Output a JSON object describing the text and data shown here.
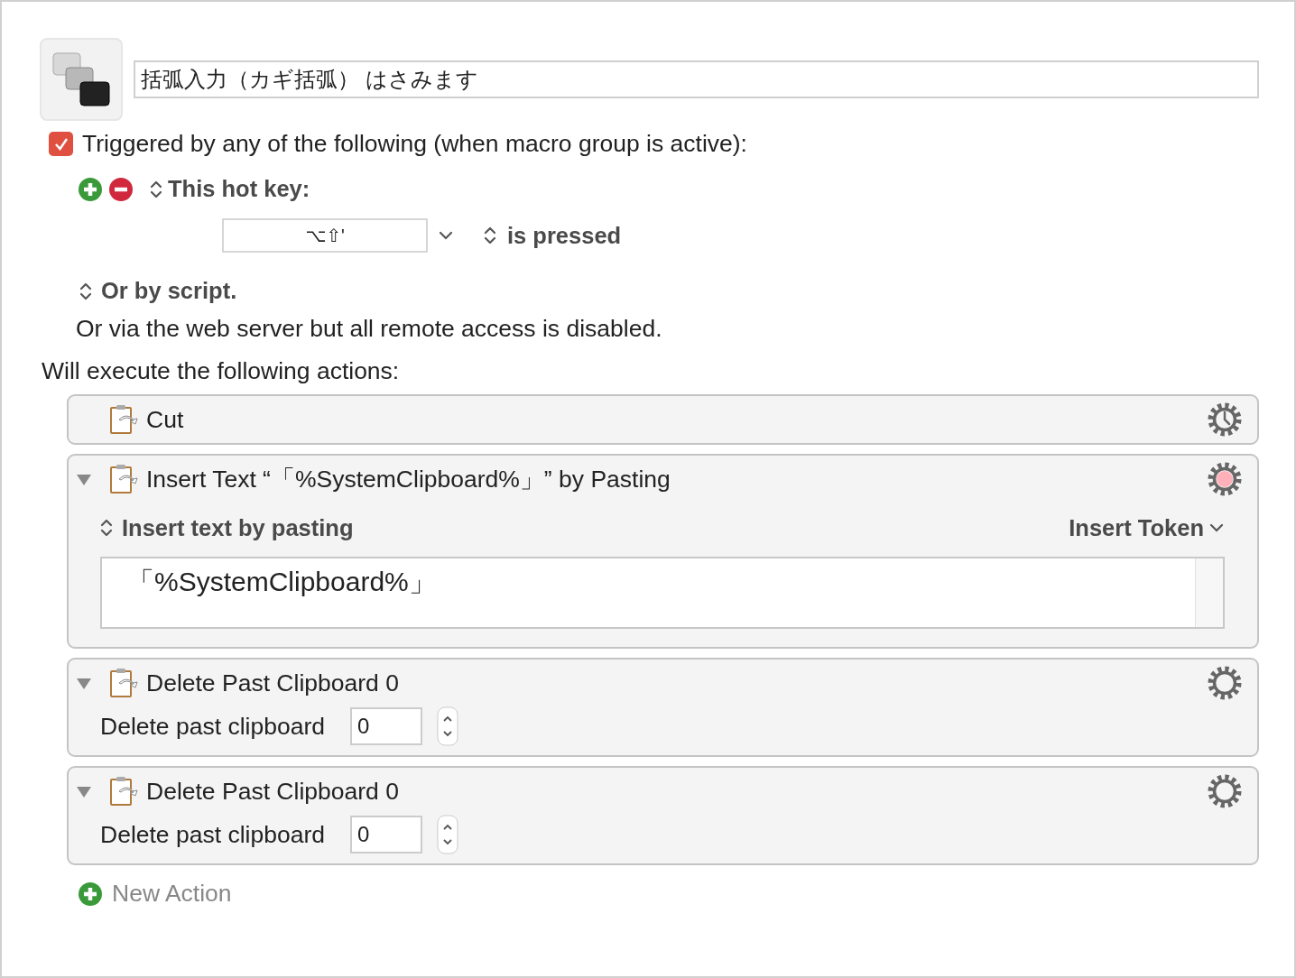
{
  "macro": {
    "name": "括弧入力（カギ括弧） はさみます"
  },
  "trigger": {
    "checked": true,
    "label": "Triggered by any of the following (when macro group is active):"
  },
  "hotkey": {
    "type_label": "This hot key:",
    "keys": "⌥⇧'",
    "state_label": "is pressed"
  },
  "script_label": "Or by script.",
  "web_server_note": "Or via the web server but all remote access is disabled.",
  "actions_heading": "Will execute the following actions:",
  "actions": [
    {
      "kind": "simple",
      "title": "Cut",
      "timed": true,
      "failed": false
    },
    {
      "kind": "insert_text",
      "title": "Insert Text “「%SystemClipboard%」” by Pasting",
      "expanded": true,
      "timed": false,
      "failed": true,
      "mode_label": "Insert text by pasting",
      "token_button": "Insert Token",
      "text": "「%SystemClipboard%」"
    },
    {
      "kind": "delete_clipboard",
      "title": "Delete Past Clipboard 0",
      "expanded": true,
      "timed": false,
      "failed": false,
      "field_label": "Delete past clipboard",
      "value": "0"
    },
    {
      "kind": "delete_clipboard",
      "title": "Delete Past Clipboard 0",
      "expanded": true,
      "timed": false,
      "failed": false,
      "field_label": "Delete past clipboard",
      "value": "0"
    }
  ],
  "new_action": "New Action"
}
